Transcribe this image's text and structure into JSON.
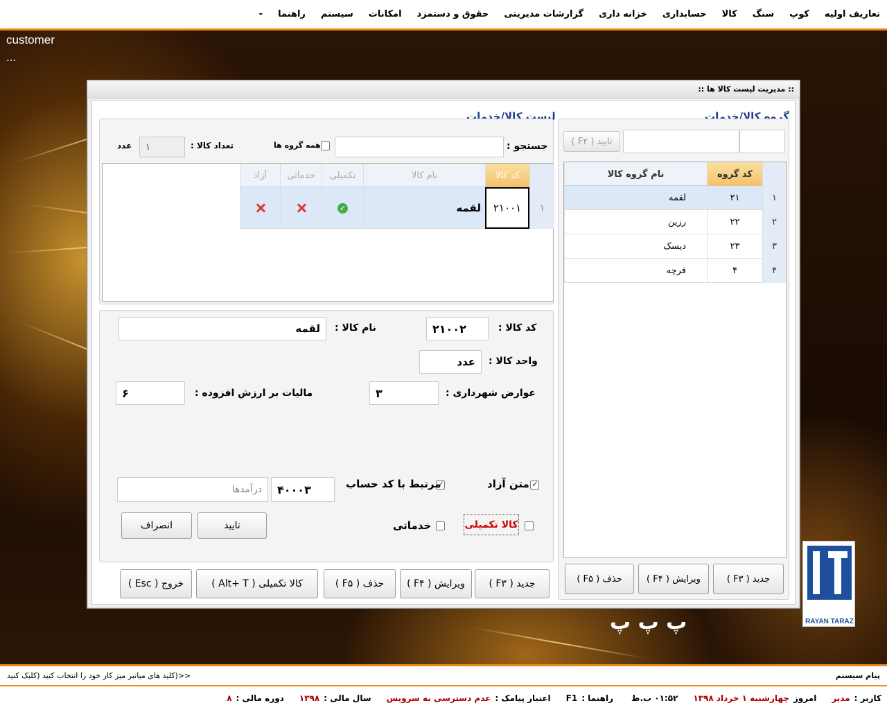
{
  "menu": [
    "تعاریف اولیه",
    "کوپ",
    "سنگ",
    "کالا",
    "حسابداری",
    "خزانه داری",
    "گزارشات مدیریتی",
    "حقوق و دستمزد",
    "امکانات",
    "سیستم",
    "راهنما",
    "-"
  ],
  "desktop": {
    "customer": "customer",
    "dots": "...",
    "logo_text": "RAYAN TARAZ",
    "glyphs": "پ پ پ"
  },
  "dialog": {
    "title": ":: مدیریت لیست کالا ها ::",
    "group_panel": {
      "title": "گروه کالا/خدمات",
      "confirm_btn": "تایید ( F۲ )",
      "columns": [
        "کد گروه",
        "نام گروه کالا"
      ],
      "rows": [
        {
          "n": "۱",
          "code": "۲۱",
          "name": "لقمه"
        },
        {
          "n": "۲",
          "code": "۲۲",
          "name": "رزین"
        },
        {
          "n": "۳",
          "code": "۲۳",
          "name": "دیسک"
        },
        {
          "n": "۴",
          "code": "۴",
          "name": "فرچه"
        }
      ],
      "buttons": {
        "new": "جدید ( F۳ )",
        "edit": "ویرایش ( F۴ )",
        "delete": "حذف ( F۵ )"
      }
    },
    "list_panel": {
      "title": "لیست کالا/خدمات",
      "search_label": "جستجو :",
      "all_groups": "همه گروه ها",
      "count_label": "تعداد کالا :",
      "count_value": "۱",
      "count_unit": "عدد",
      "columns": {
        "code": "کد کالا",
        "name": "نام کالا",
        "extra": "تکمیلی",
        "service": "خدماتی",
        "free": "آزاد"
      },
      "rows": [
        {
          "n": "۱",
          "code": "۲۱۰۰۱",
          "name": "لقمه"
        }
      ]
    },
    "form": {
      "code_label": "کد کالا :",
      "code_value": "۲۱۰۰۲",
      "name_label": "نام کالا :",
      "name_value": "لقمه",
      "unit_label": "واحد کالا :",
      "unit_value": "عدد",
      "muni_label": "عوارض شهرداری :",
      "muni_value": "۳",
      "vat_label": "مالیات بر ارزش افزوده :",
      "vat_value": "۶",
      "free_text_label": "متن آزاد",
      "linked_label": "مرتبط با کد حساب",
      "account_code": "۴۰۰۰۳",
      "account_name": "درآمدها",
      "extra_label": "کالا تکمیلی",
      "service_label": "خدماتی",
      "confirm": "تایید",
      "cancel": "انصراف"
    },
    "bottom_buttons": {
      "new": "جدید  ( F۳ )",
      "edit": "ویرایش ( F۴ )",
      "delete": "حذف ( F۵ )",
      "extra": "کالا تکمیلی ( Alt+ T )",
      "exit": "خروج ( Esc )"
    }
  },
  "message_bar": {
    "label": "پیام سیستم",
    "hint": "<<(کلید های میانبر میز کار خود را انتخاب کنید (کلیک کنید"
  },
  "status": {
    "user_label": "کاربر :",
    "user": "مدیر",
    "today_label": "امروز",
    "today": "چهارشنبه ۱ خرداد ۱۳۹۸",
    "time": "۰۱:۵۲ ب.ظ",
    "help_label": "راهنما :",
    "help": "F1",
    "sms_label": "اعتبار پیامک :",
    "sms": "عدم دسترسی به سرویس",
    "fy_label": "سال مالی :",
    "fy": "۱۳۹۸",
    "period_label": "دوره مالی :",
    "period": "۸"
  },
  "colors": {
    "accent": "#f08a1c",
    "title_blue": "#1f3d8a",
    "status_red": "#a80000"
  }
}
